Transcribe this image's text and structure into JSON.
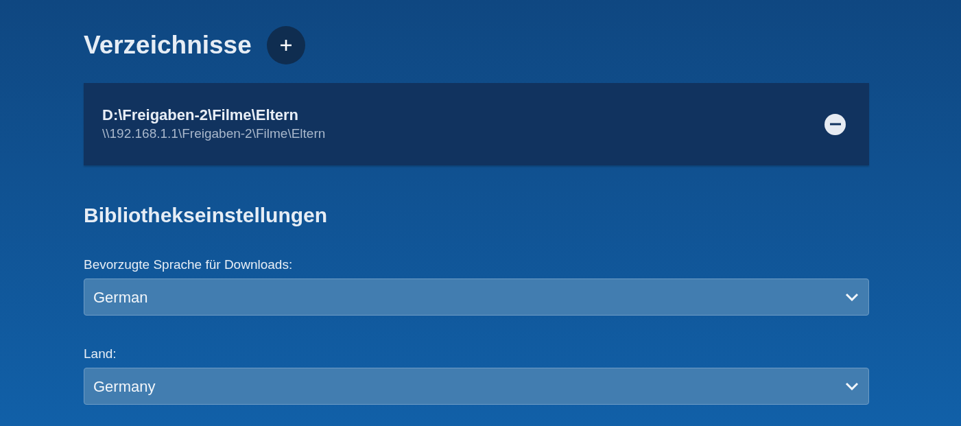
{
  "directories": {
    "title": "Verzeichnisse",
    "items": [
      {
        "path": "D:\\Freigaben-2\\Filme\\Eltern",
        "network_path": "\\\\192.168.1.1\\Freigaben-2\\Filme\\Eltern"
      }
    ]
  },
  "library_settings": {
    "title": "Bibliothekseinstellungen",
    "fields": [
      {
        "label": "Bevorzugte Sprache für Downloads:",
        "value": "German"
      },
      {
        "label": "Land:",
        "value": "Germany"
      }
    ]
  }
}
